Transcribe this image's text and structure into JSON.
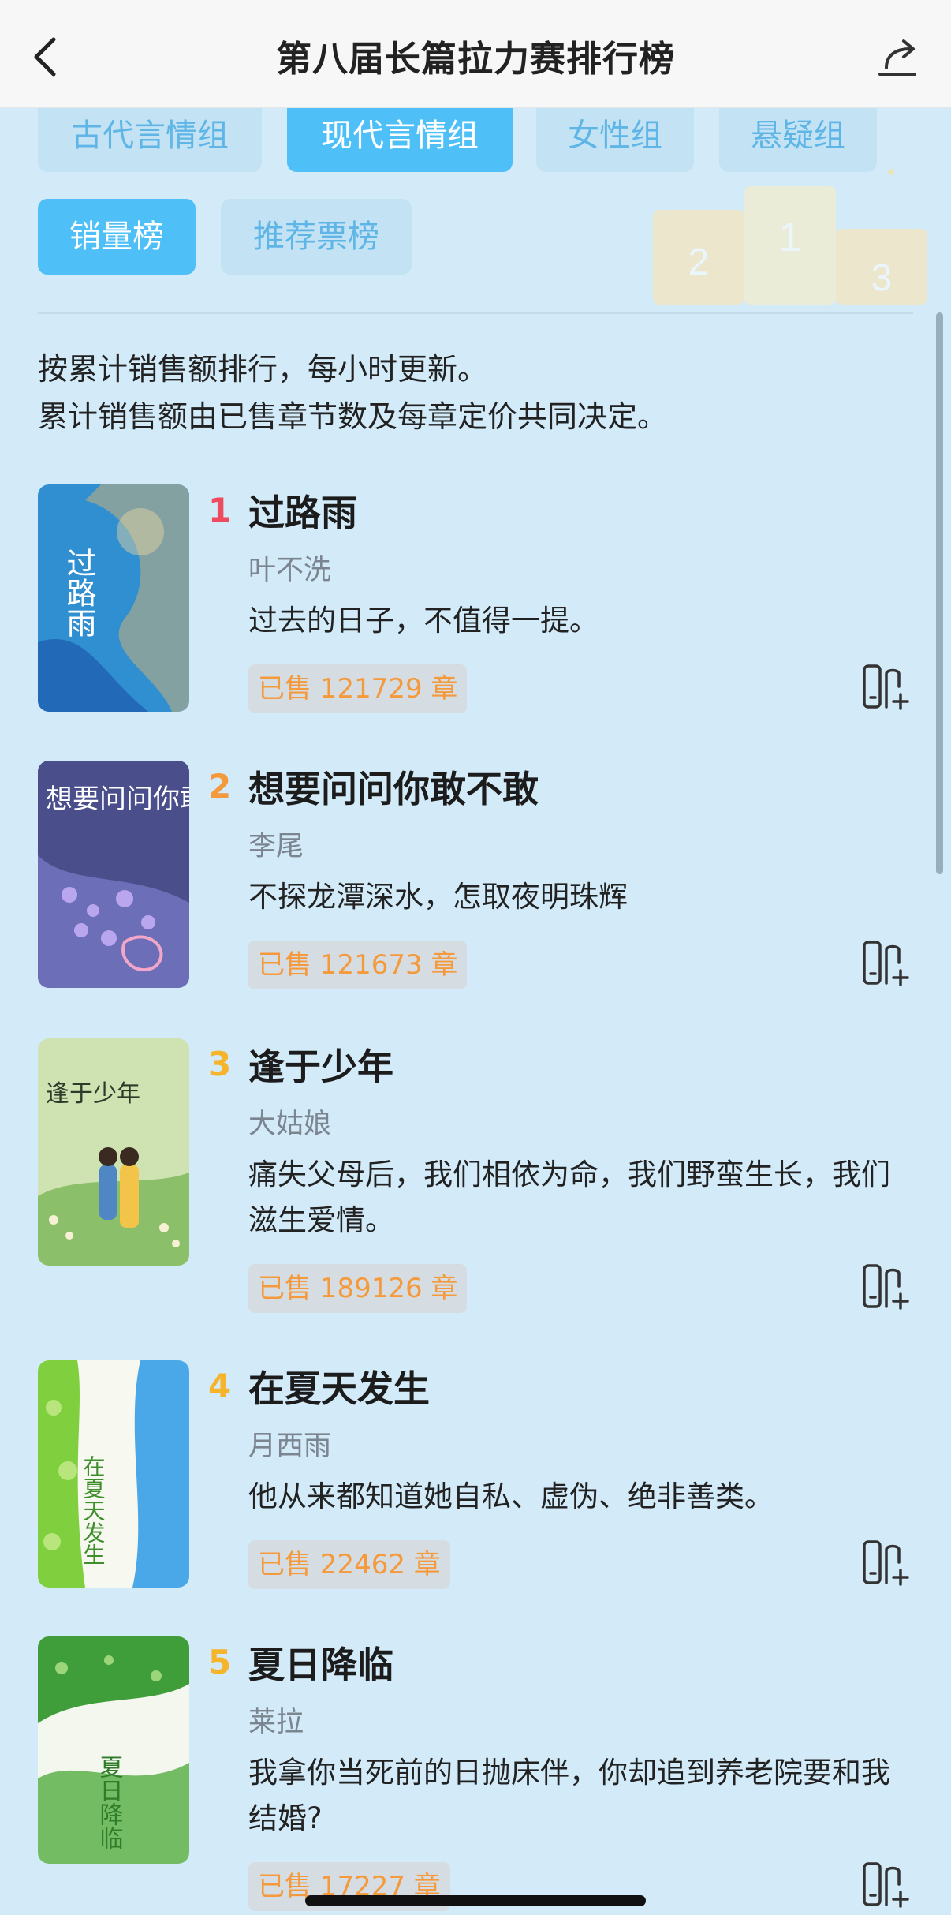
{
  "header": {
    "title": "第八届长篇拉力赛排行榜",
    "back_icon": "chevron-left-icon",
    "share_icon": "share-icon"
  },
  "podium": {
    "labels": [
      "2",
      "1",
      "3"
    ]
  },
  "category_tabs": [
    {
      "label": "古代言情组",
      "active": false
    },
    {
      "label": "现代言情组",
      "active": true
    },
    {
      "label": "女性组",
      "active": false
    },
    {
      "label": "悬疑组",
      "active": false
    }
  ],
  "list_tabs": [
    {
      "label": "销量榜",
      "active": true
    },
    {
      "label": "推荐票榜",
      "active": false
    }
  ],
  "description": {
    "line1": "按累计销售额排行，每小时更新。",
    "line2": "累计销售额由已售章节数及每章定价共同决定。"
  },
  "books": [
    {
      "rank": "1",
      "title": "过路雨",
      "author": "叶不洗",
      "summary": "过去的日子，不值得一提。",
      "sold": "已售 121729 章",
      "cover_text": "过路雨",
      "rank_color": "#ef4b5f"
    },
    {
      "rank": "2",
      "title": "想要问问你敢不敢",
      "author": "李尾",
      "summary": "不探龙潭深水，怎取夜明珠辉",
      "sold": "已售 121673 章",
      "cover_text": "想要问问你敢不敢",
      "rank_color": "#f59a3c"
    },
    {
      "rank": "3",
      "title": "逢于少年",
      "author": "大姑娘",
      "summary": "痛失父母后，我们相依为命，我们野蛮生长，我们滋生爱情。",
      "sold": "已售 189126 章",
      "cover_text": "逢于少年",
      "rank_color": "#f5b42a"
    },
    {
      "rank": "4",
      "title": "在夏天发生",
      "author": "月西雨",
      "summary": "他从来都知道她自私、虚伪、绝非善类。",
      "sold": "已售 22462 章",
      "cover_text": "在夏天发生",
      "rank_color": "#f5b42a"
    },
    {
      "rank": "5",
      "title": "夏日降临",
      "author": "莱拉",
      "summary": "我拿你当死前的日抛床伴，你却追到养老院要和我结婚?",
      "sold": "已售 17227 章",
      "cover_text": "夏日降临",
      "rank_color": "#f5b42a"
    }
  ],
  "colors": {
    "accent": "#4fc0f7",
    "background": "#d3ebf9",
    "sold_text": "#f59a3c"
  }
}
